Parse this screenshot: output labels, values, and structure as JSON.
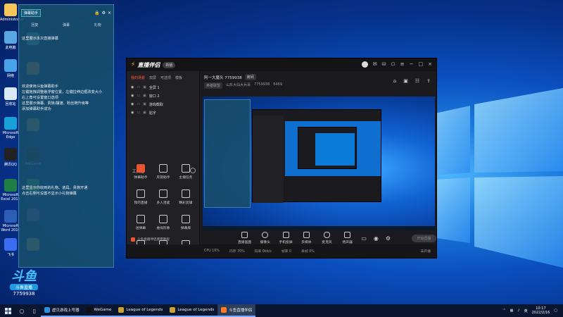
{
  "desktop": {
    "icons_left": [
      {
        "label": "Administrator",
        "color": "#f3c55a"
      },
      {
        "label": "此电脑",
        "color": "#5aa7e6"
      },
      {
        "label": "网络",
        "color": "#4aa3e8"
      },
      {
        "label": "回收站",
        "color": "#d9e8f5"
      },
      {
        "label": "Microsoft Edge",
        "color": "#1aa0d8"
      },
      {
        "label": "腾讯QQ",
        "color": "#222"
      },
      {
        "label": "Microsoft Excel 2010",
        "color": "#1e7e45"
      },
      {
        "label": "Microsoft Word 2010",
        "color": "#2a5fb5"
      },
      {
        "label": "飞书",
        "color": "#3a6df0"
      },
      {
        "label": "WeGame",
        "color": "#e53935"
      }
    ],
    "icons_right": [
      {
        "label": "",
        "color": "#6ac"
      },
      {
        "label": "",
        "color": "#c84"
      },
      {
        "label": "",
        "color": "#a86"
      },
      {
        "label": "WeGame",
        "color": "#111"
      },
      {
        "label": "",
        "color": "#4a6"
      },
      {
        "label": "",
        "color": "#66a"
      },
      {
        "label": "",
        "color": "#b96"
      }
    ]
  },
  "chat_panel": {
    "badge": "弹幕助手",
    "tabs": [
      "回复",
      "弹幕",
      "礼物"
    ],
    "messages": [
      "这里展示本次直播弹幕",
      "欢迎使用斗鱼弹幕助手\n左键拖拽调整悬浮窗位置，左键拉伸边框改变大小\n右上角可设置窗口选项\n这里展示弹幕、贵族/摆渡、粉丝牌升级等\n添加弹幕助手成功",
      "这里显示你收到的礼物、道具、贵族开通\n点击右侧可设置不显示小礼物弹幕"
    ],
    "logo_room_id": "7759938",
    "logo_text": "斗鱼直播"
  },
  "app": {
    "brand": "直播伴侣",
    "version": "新版",
    "tabs": [
      "我的场景",
      "双屏",
      "可选项",
      "模板"
    ],
    "scenes": [
      "全屏 1",
      "窗口 2",
      "游戏截取",
      "贴字"
    ],
    "tools_title": "工具箱",
    "tools": [
      {
        "label": "弹幕助手",
        "hot": true
      },
      {
        "label": "房管助手",
        "hot": false
      },
      {
        "label": "主播任务",
        "hot": false
      },
      {
        "label": "我的直播",
        "hot": false
      },
      {
        "label": "多人连麦",
        "hot": false
      },
      {
        "label": "精彩剪辑",
        "hot": false
      },
      {
        "label": "送弹幕",
        "hot": false
      },
      {
        "label": "虚拟形象",
        "hot": false
      },
      {
        "label": "弹幕库",
        "hot": false
      },
      {
        "label": "",
        "hot": false
      },
      {
        "label": "",
        "hot": false
      },
      {
        "label": "",
        "hot": false
      }
    ],
    "left_footer": "斗鱼直播伴侣使用教程",
    "room": {
      "title": "阿一大魔头 7759938",
      "tag": "房间",
      "category": "英雄联盟",
      "sub": "山东大仙大兵哥",
      "room_id": "7759938",
      "heat": "6469"
    },
    "controls": [
      "直播画面",
      "摄像头",
      "手机投屏",
      "多媒体",
      "麦克风",
      "扬声器"
    ],
    "go_live": "开始直播",
    "status_items": [
      "CPU 16%",
      "内存 70%",
      "码率 0kb/s",
      "帧率 0",
      "丢帧 0%",
      "未开播"
    ]
  },
  "taskbar": {
    "items": [
      {
        "label": "虚贝游戏上号器",
        "color": "#2a90e0",
        "active": false
      },
      {
        "label": "WeGame",
        "color": "#111",
        "active": false
      },
      {
        "label": "League of Legends",
        "color": "#c9a23b",
        "active": false
      },
      {
        "label": "League of Legends",
        "color": "#c9a23b",
        "active": false
      },
      {
        "label": "斗鱼直播伴侣",
        "color": "#ff7a29",
        "active": true
      }
    ],
    "time": "10:17",
    "date": "2022/2/16",
    "lang": "英"
  }
}
